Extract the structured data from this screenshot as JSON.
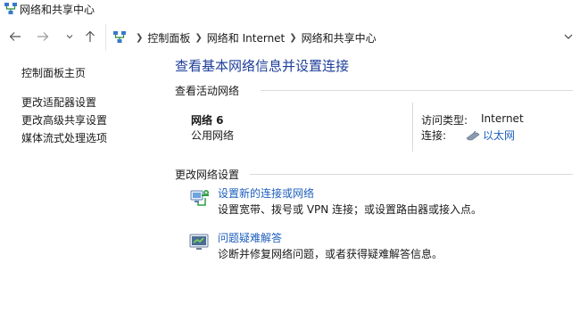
{
  "window": {
    "title": "网络和共享中心",
    "icon": "network-center-icon"
  },
  "nav": {
    "back_icon": "arrow-left-icon",
    "forward_icon": "arrow-right-icon",
    "up_icon": "arrow-up-icon",
    "breadcrumb": [
      "控制面板",
      "网络和 Internet",
      "网络和共享中心"
    ],
    "dropdown_icon": "chevron-down-icon"
  },
  "sidebar": {
    "home": "控制面板主页",
    "links": [
      "更改适配器设置",
      "更改高级共享设置",
      "媒体流式处理选项"
    ]
  },
  "main": {
    "title": "查看基本网络信息并设置连接",
    "active_section": "查看活动网络",
    "network": {
      "name": "网络 6",
      "type": "公用网络",
      "access_label": "访问类型:",
      "access_value": "Internet",
      "connection_label": "连接:",
      "connection_value": "以太网"
    },
    "change_section": "更改网络设置",
    "tasks": [
      {
        "icon": "new-connection-icon",
        "link": "设置新的连接或网络",
        "desc": "设置宽带、拨号或 VPN 连接；或设置路由器或接入点。"
      },
      {
        "icon": "troubleshoot-icon",
        "link": "问题疑难解答",
        "desc": "诊断并修复网络问题，或者获得疑难解答信息。"
      }
    ]
  },
  "colors": {
    "title_blue": "#1e3e9a",
    "link_blue": "#1e5fbd"
  }
}
